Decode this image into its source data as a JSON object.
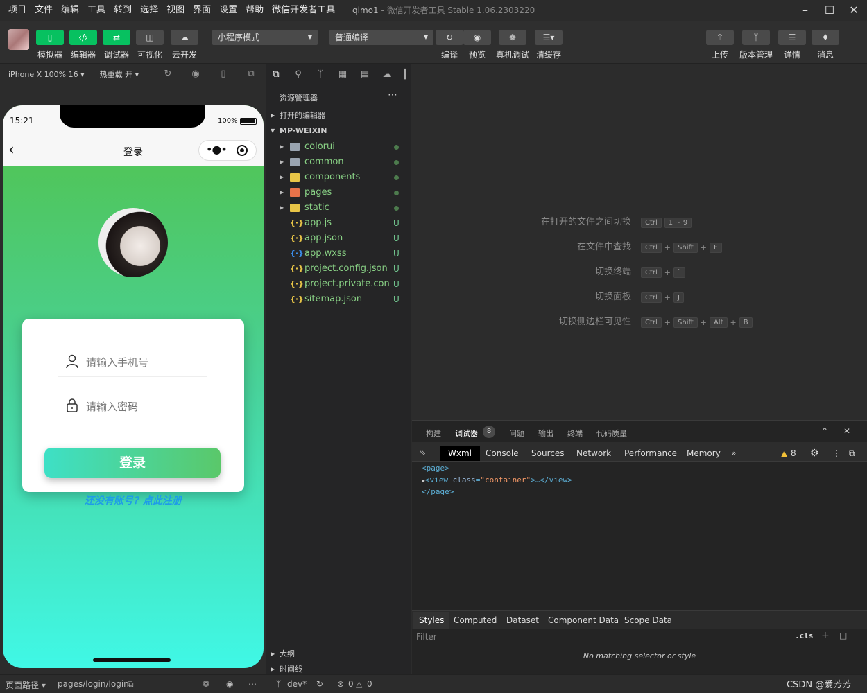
{
  "menu": [
    "项目",
    "文件",
    "编辑",
    "工具",
    "转到",
    "选择",
    "视图",
    "界面",
    "设置",
    "帮助",
    "微信开发者工具"
  ],
  "window": {
    "project": "qimo1",
    "separator": " - ",
    "app": "微信开发者工具 Stable 1.06.2303220"
  },
  "toolbar": {
    "simulator": "模拟器",
    "editor": "编辑器",
    "debugger": "调试器",
    "visual": "可视化",
    "cloud": "云开发",
    "mode": "小程序模式",
    "compile_mode": "普通编译",
    "compile": "编译",
    "preview": "预览",
    "remote_debug": "真机调试",
    "clear_cache": "清缓存",
    "upload": "上传",
    "version": "版本管理",
    "details": "详情",
    "messages": "消息"
  },
  "simbar": {
    "device": "iPhone X 100% 16",
    "hotreload": "热重载 开"
  },
  "phone": {
    "time": "15:21",
    "battery": "100%",
    "nav_title": "登录",
    "phone_placeholder": "请输入手机号",
    "password_placeholder": "请输入密码",
    "login_label": "登录",
    "register_link": "还没有账号？点此注册"
  },
  "explorer": {
    "title": "资源管理器",
    "open_editors": "打开的编辑器",
    "root": "MP-WEIXIN",
    "items": [
      {
        "name": "colorui",
        "type": "folder",
        "status": "",
        "color": "#9aa4b0"
      },
      {
        "name": "common",
        "type": "folder",
        "status": "",
        "color": "#9aa4b0"
      },
      {
        "name": "components",
        "type": "folder",
        "status": "",
        "color": "#e8c547"
      },
      {
        "name": "pages",
        "type": "folder",
        "status": "",
        "color": "#e8734a"
      },
      {
        "name": "static",
        "type": "folder",
        "status": "",
        "color": "#e8c547"
      },
      {
        "name": "app.js",
        "type": "file",
        "status": "U",
        "color": "#e8c547"
      },
      {
        "name": "app.json",
        "type": "file",
        "status": "U",
        "color": "#e8c547"
      },
      {
        "name": "app.wxss",
        "type": "file",
        "status": "U",
        "color": "#3b8eea"
      },
      {
        "name": "project.config.json",
        "type": "file",
        "status": "U",
        "color": "#e8c547"
      },
      {
        "name": "project.private.confi...",
        "type": "file",
        "status": "U",
        "color": "#e8c547"
      },
      {
        "name": "sitemap.json",
        "type": "file",
        "status": "U",
        "color": "#e8c547"
      }
    ],
    "outline": "大纲",
    "timeline": "时间线"
  },
  "shortcuts": [
    {
      "label": "在打开的文件之间切换",
      "keys": [
        "Ctrl",
        "1 ~ 9"
      ]
    },
    {
      "label": "在文件中查找",
      "keys": [
        "Ctrl",
        "+",
        "Shift",
        "+",
        "F"
      ]
    },
    {
      "label": "切换终端",
      "keys": [
        "Ctrl",
        "+",
        "`"
      ]
    },
    {
      "label": "切换面板",
      "keys": [
        "Ctrl",
        "+",
        "J"
      ]
    },
    {
      "label": "切换侧边栏可见性",
      "keys": [
        "Ctrl",
        "+",
        "Shift",
        "+",
        "Alt",
        "+",
        "B"
      ]
    }
  ],
  "debug": {
    "tabs": [
      "构建",
      "调试器",
      "问题",
      "输出",
      "终端",
      "代码质量"
    ],
    "badge": "8",
    "devtools": [
      "Wxml",
      "Console",
      "Sources",
      "Network",
      "Performance",
      "Memory"
    ],
    "warnings": "8",
    "code": {
      "l1": "<page>",
      "l2_open": "<view ",
      "l2_attr": "class",
      "l2_eq": "=",
      "l2_val": "\"container\"",
      "l2_close": ">…</view>",
      "l3": "</page>"
    },
    "style_tabs": [
      "Styles",
      "Computed",
      "Dataset",
      "Component Data",
      "Scope Data"
    ],
    "filter_placeholder": "Filter",
    "cls": ".cls",
    "no_match": "No matching selector or style"
  },
  "status": {
    "path_label": "页面路径",
    "path": "pages/login/login",
    "branch": "dev*",
    "errors": "0",
    "warnings": "0",
    "watermark": "CSDN @爱芳芳"
  },
  "colors": {
    "accent_green": "#07c160",
    "phone_top": "#52c24a",
    "phone_bottom": "#40f8e6"
  }
}
